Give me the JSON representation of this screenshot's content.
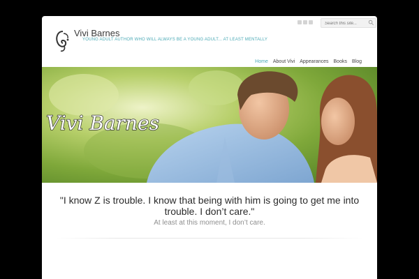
{
  "site": {
    "title": "Vivi Barnes",
    "tagline": "YOUNG ADULT AUTHOR WHO WILL ALWAYS BE A YOUNG ADULT... AT LEAST MENTALLY"
  },
  "search": {
    "placeholder": "Search this site..."
  },
  "social": [
    "twitter-icon",
    "rss-icon",
    "facebook-icon"
  ],
  "nav": [
    {
      "label": "Home",
      "active": true
    },
    {
      "label": "About Vivi",
      "active": false
    },
    {
      "label": "Appearances",
      "active": false
    },
    {
      "label": "Books",
      "active": false
    },
    {
      "label": "Blog",
      "active": false
    }
  ],
  "hero": {
    "script_title": "Vivi Barnes"
  },
  "quote": {
    "text": "\"I know Z is trouble. I know that being with him is going to get me into trouble. I don’t care.\"",
    "sub": "At least at this moment, I don’t care."
  },
  "colors": {
    "accent": "#4aa9b5",
    "background": "#000000"
  }
}
